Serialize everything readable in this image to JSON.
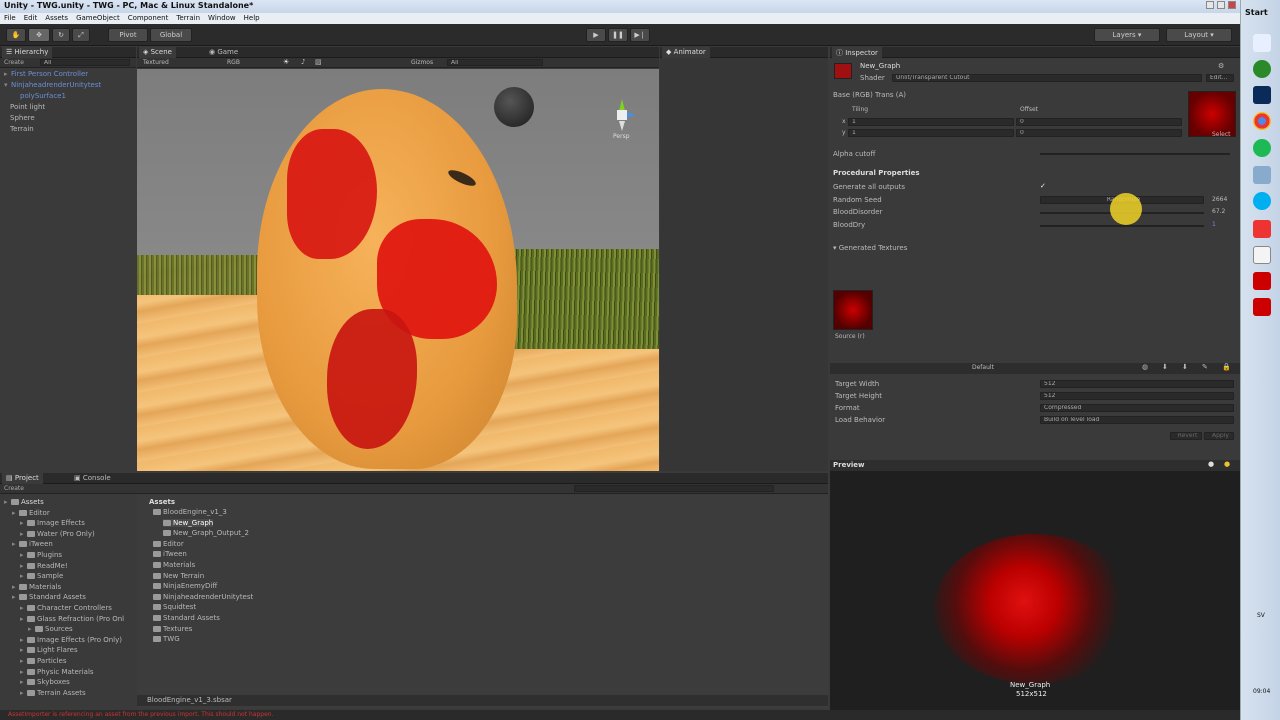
{
  "window": {
    "title": "Unity - TWG.unity - TWG - PC, Mac & Linux Standalone*"
  },
  "menu": [
    "File",
    "Edit",
    "Assets",
    "GameObject",
    "Component",
    "Terrain",
    "Window",
    "Help"
  ],
  "toolbar": {
    "pivot": "Pivot",
    "global": "Global",
    "layers": "Layers",
    "layout": "Layout"
  },
  "hierarchy": {
    "tab": "Hierarchy",
    "create": "Create",
    "search": "All",
    "items": [
      "First Person Controller",
      "NinjaheadrenderUnitytest",
      "polySurface1",
      "Point light",
      "Sphere",
      "Terrain"
    ]
  },
  "scene": {
    "tab_scene": "Scene",
    "tab_game": "Game",
    "shading": "Textured",
    "rgb": "RGB",
    "gizmos": "Gizmos",
    "search": "All",
    "persp": "Persp"
  },
  "animator": {
    "tab": "Animator"
  },
  "inspector": {
    "tab": "Inspector",
    "name": "New_Graph",
    "shader_label": "Shader",
    "shader": "Unlit/Transparent Cutout",
    "edit": "Edit...",
    "base": "Base (RGB) Trans (A)",
    "tiling": "Tiling",
    "offset": "Offset",
    "x": "x",
    "y": "y",
    "tx": "1",
    "ty": "1",
    "ox": "0",
    "oy": "0",
    "select": "Select",
    "alpha": "Alpha cutoff",
    "proc": "Procedural Properties",
    "gen_all": "Generate all outputs",
    "seed": "Random Seed",
    "randomize": "Randomize",
    "seed_val": "2664",
    "disorder": "BloodDisorder",
    "disorder_val": "67.2",
    "dry": "BloodDry",
    "dry_val": "1",
    "gen_tex": "Generated Textures",
    "source": "Source (r)",
    "default": "Default",
    "tw": "Target Width",
    "tw_val": "512",
    "th": "Target Height",
    "th_val": "512",
    "format": "Format",
    "format_val": "Compressed",
    "load": "Load Behavior",
    "load_val": "Build on level load",
    "revert": "Revert",
    "apply": "Apply"
  },
  "preview": {
    "title": "Preview",
    "name": "New_Graph",
    "size": "512x512"
  },
  "project": {
    "tab": "Project",
    "console": "Console",
    "create": "Create",
    "tree": [
      [
        "Assets",
        0
      ],
      [
        "Editor",
        1
      ],
      [
        "Image Effects",
        2
      ],
      [
        "Water (Pro Only)",
        2
      ],
      [
        "iTween",
        1
      ],
      [
        "Plugins",
        2
      ],
      [
        "ReadMe!",
        2
      ],
      [
        "Sample",
        2
      ],
      [
        "Materials",
        1
      ],
      [
        "Standard Assets",
        1
      ],
      [
        "Character Controllers",
        2
      ],
      [
        "Glass Refraction (Pro Onl",
        2
      ],
      [
        "Sources",
        3
      ],
      [
        "Image Effects (Pro Only)",
        2
      ],
      [
        "Light Flares",
        2
      ],
      [
        "Particles",
        2
      ],
      [
        "Physic Materials",
        2
      ],
      [
        "Skyboxes",
        2
      ],
      [
        "Terrain Assets",
        2
      ]
    ],
    "assets_header": "Assets",
    "files": [
      [
        "BloodEngine_v1_3",
        0
      ],
      [
        "New_Graph",
        1
      ],
      [
        "New_Graph_Output_2",
        1
      ],
      [
        "Editor",
        0
      ],
      [
        "iTween",
        0
      ],
      [
        "Materials",
        0
      ],
      [
        "New Terrain",
        0
      ],
      [
        "NinjaEnemyDiff",
        0
      ],
      [
        "NinjaheadrenderUnitytest",
        0
      ],
      [
        "Squidtest",
        0
      ],
      [
        "Standard Assets",
        0
      ],
      [
        "Textures",
        0
      ],
      [
        "TWG",
        0
      ]
    ],
    "footer": "BloodEngine_v1_3.sbsar"
  },
  "status": {
    "error": "AssetImporter is referencing an asset from the previous import. This should not happen."
  },
  "taskbar": {
    "start": "Start",
    "lang": "SV",
    "time": "09:04"
  }
}
